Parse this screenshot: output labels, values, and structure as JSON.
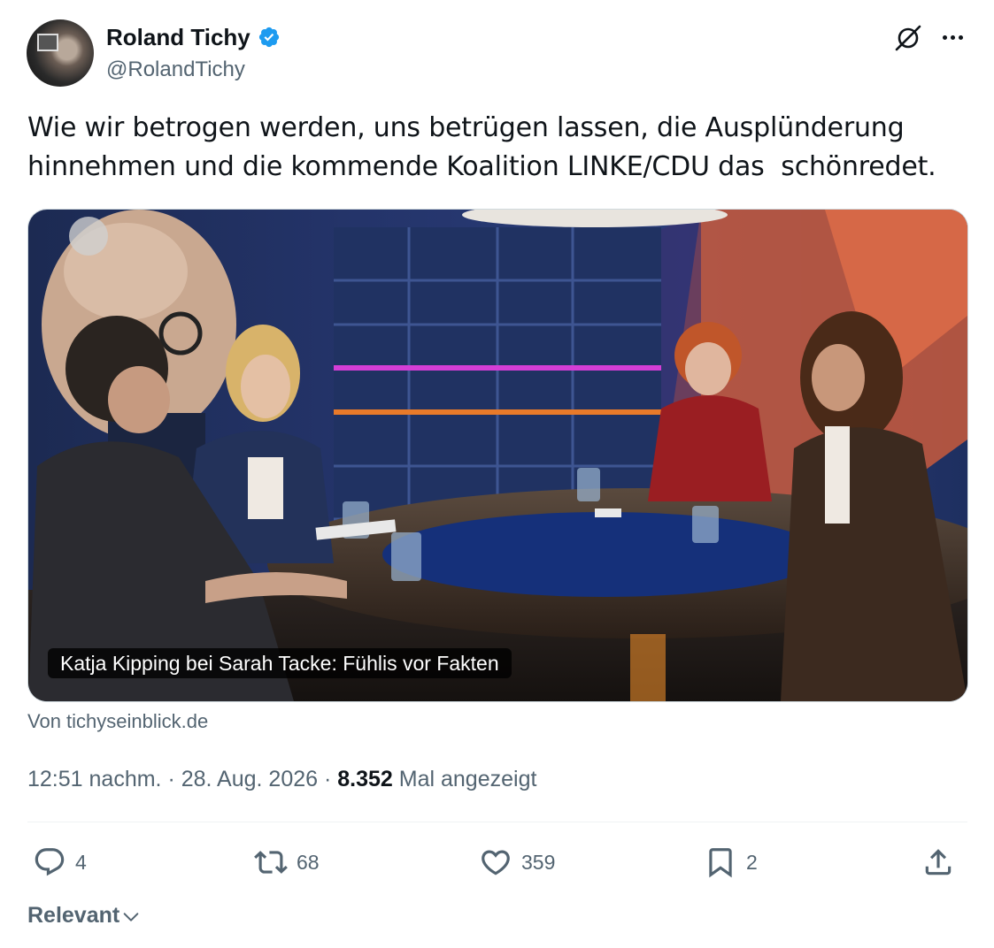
{
  "author": {
    "display_name": "Roland Tichy",
    "handle": "@RolandTichy",
    "verified": true,
    "verified_color": "#1d9bf0"
  },
  "tweet": {
    "text": "Wie wir betrogen werden, uns betrügen lassen, die Ausplünderung\nhinnehmen und die kommende Koalition LINKE/CDU das  schönredet."
  },
  "link_card": {
    "caption": "Katja Kipping bei Sarah Tacke: Fühlis vor Fakten",
    "source": "Von tichyseinblick.de"
  },
  "meta": {
    "time": "12:51 nachm.",
    "separator": " · ",
    "date": "28. Aug. 2026",
    "views_count": "8.352",
    "views_label": "Mal angezeigt"
  },
  "actions": {
    "replies": "4",
    "reposts": "68",
    "likes": "359",
    "bookmarks": "2"
  },
  "icons": {
    "grok": "grok-icon",
    "more": "more-icon",
    "reply": "reply-icon",
    "repost": "repost-icon",
    "like": "heart-icon",
    "bookmark": "bookmark-icon",
    "share": "share-icon",
    "chevron": "chevron-down-icon"
  },
  "replies_sort": {
    "label": "Relevant"
  }
}
